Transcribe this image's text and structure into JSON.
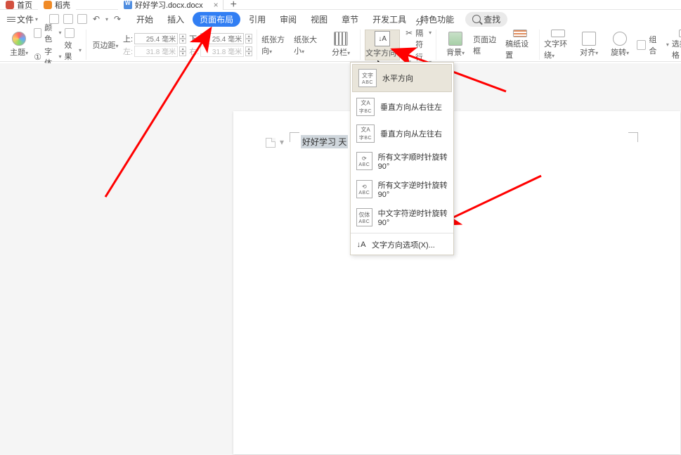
{
  "tabs": {
    "home": "首页",
    "dokshell": "稻壳",
    "doc": "好好学习.docx.docx"
  },
  "menu": {
    "file": "文件",
    "start": "开始",
    "insert": "插入",
    "pagelayout": "页面布局",
    "reference": "引用",
    "review": "审阅",
    "view": "视图",
    "chapter": "章节",
    "devtools": "开发工具",
    "special": "特色功能",
    "search": "查找"
  },
  "ribbon": {
    "theme": "主题",
    "color": "颜色",
    "font": "字体",
    "effect": "效果",
    "marginGroup": {
      "top": "上:",
      "topVal": "25.4 毫米",
      "bottom": "下:",
      "bottomVal": "25.4 毫米",
      "left": "左:",
      "leftVal": "31.8 毫米",
      "right": "右:",
      "rightVal": "31.8 毫米",
      "pageMargin": "页边距"
    },
    "paperDir": "纸张方向",
    "paperSize": "纸张大小",
    "columns": "分栏",
    "textDir": "文字方向",
    "breaks": "分隔符",
    "lineNum": "行号",
    "background": "背景",
    "pageBorder": "页面边框",
    "paperSetting": "稿纸设置",
    "textWrap": "文字环绕",
    "align": "对齐",
    "rotate": "旋转",
    "group": "组合",
    "selPane": "选择窗格"
  },
  "dropdown": {
    "horizontal": "水平方向",
    "vertRL": "垂直方向从右往左",
    "vertLR": "垂直方向从左往右",
    "rotCW": "所有文字顺时针旋转90°",
    "rotCCW": "所有文字逆时针旋转90°",
    "cjkCCW": "中文字符逆时针旋转90°",
    "options": "文字方向选项(X)..."
  },
  "doc": {
    "selected": "好好学习   天"
  }
}
